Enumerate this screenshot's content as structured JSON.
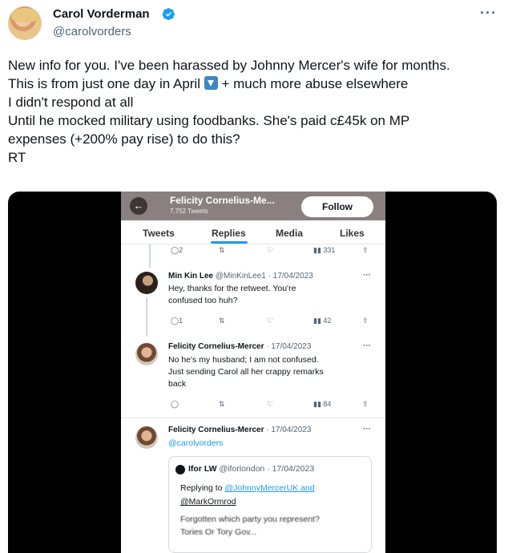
{
  "tweet": {
    "display_name": "Carol Vorderman",
    "handle": "@carolvorders",
    "verified_icon": "verified-badge-icon",
    "more_icon": "more-icon",
    "more_label": "···",
    "lines": [
      "New info for you. I've been harassed by Johnny Mercer's wife for months.",
      "This is from just one day in April",
      "+ much more abuse elsewhere",
      "I didn't respond at all",
      "Until he mocked military using foodbanks. She's paid c£45k on MP",
      "expenses (+200% pay rise) to do this?",
      "RT"
    ]
  },
  "screenshot": {
    "header": {
      "back_label": "←",
      "name": "Felicity Cornelius-Me...",
      "count": "7,752 Tweets",
      "follow_label": "Follow"
    },
    "tabs": [
      "Tweets",
      "Replies",
      "Media",
      "Likes"
    ],
    "top_actions": {
      "replies": "2",
      "views": "331"
    },
    "replies": [
      {
        "name": "Min Kin Lee",
        "meta": "@MinKinLee1 · 17/04/2023",
        "text": [
          "Hey, thanks for the retweet. You're",
          "confused too huh?"
        ],
        "replies": "1",
        "views": "42"
      },
      {
        "name": "Felicity Cornelius-Mercer",
        "meta": "· 17/04/2023",
        "text": [
          "No he's my husband; I am not confused.",
          "Just sending Carol all her crappy remarks",
          "back"
        ],
        "replies": "",
        "views": "84"
      },
      {
        "name": "Felicity Cornelius-Mercer",
        "meta": "· 17/04/2023",
        "mention": "@carolvorders"
      }
    ],
    "quote": {
      "name": "Ifor LW",
      "meta": "@iforlondon · 17/04/2023",
      "replying_prefix": "Replying to",
      "replying_to_1": "@JohnnyMercerUK and",
      "replying_to_2": "@MarkOrmrod",
      "text_1": "Forgotten which party you represent?",
      "text_2": "Tories Or Tory Gov..."
    },
    "dots_label": "···"
  }
}
